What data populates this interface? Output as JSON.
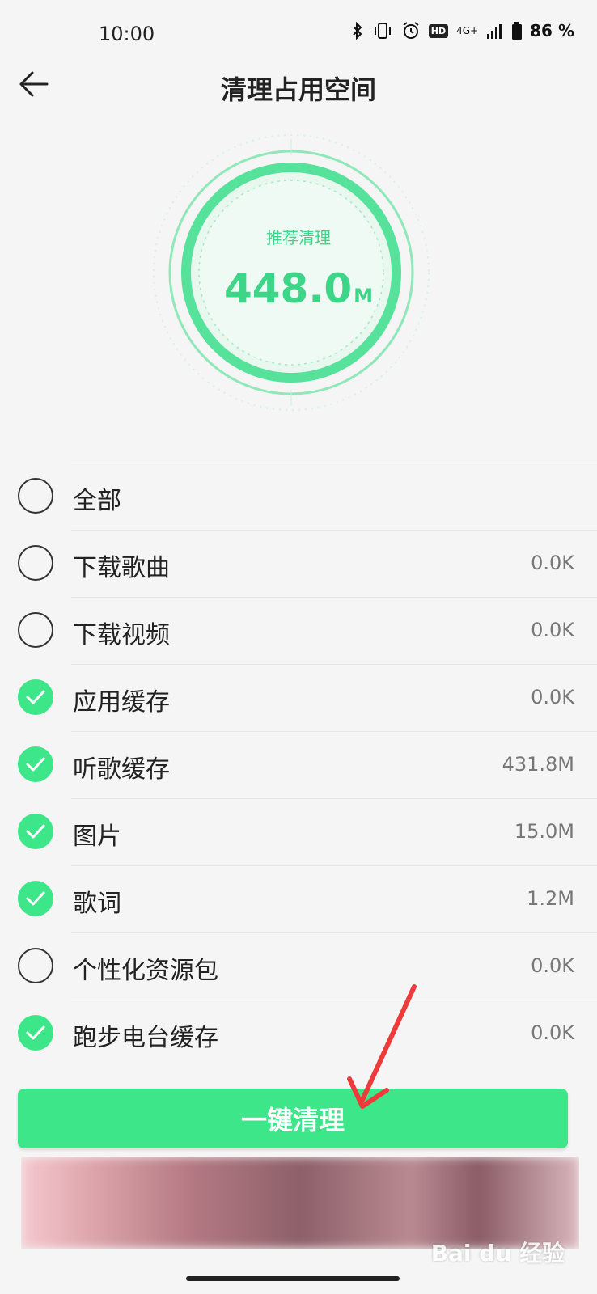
{
  "status_bar": {
    "time": "10:00",
    "hd": "HD",
    "network": "4G+",
    "battery_pct": "86",
    "percent_sign": "%"
  },
  "header": {
    "title": "清理占用空间"
  },
  "gauge": {
    "label": "推荐清理",
    "value": "448.0",
    "unit": "M",
    "accent_color": "#3dd688"
  },
  "items": [
    {
      "label": "全部",
      "size": "",
      "checked": false
    },
    {
      "label": "下载歌曲",
      "size": "0.0K",
      "checked": false
    },
    {
      "label": "下载视频",
      "size": "0.0K",
      "checked": false
    },
    {
      "label": "应用缓存",
      "size": "0.0K",
      "checked": true
    },
    {
      "label": "听歌缓存",
      "size": "431.8M",
      "checked": true
    },
    {
      "label": "图片",
      "size": "15.0M",
      "checked": true
    },
    {
      "label": "歌词",
      "size": "1.2M",
      "checked": true
    },
    {
      "label": "个性化资源包",
      "size": "0.0K",
      "checked": false
    },
    {
      "label": "跑步电台缓存",
      "size": "0.0K",
      "checked": true
    }
  ],
  "action": {
    "clean_label": "一键清理",
    "button_color": "#3ee68a"
  },
  "watermark": "Bai du 经验",
  "icons": {
    "back": "arrow-left-icon",
    "check": "check-icon"
  }
}
